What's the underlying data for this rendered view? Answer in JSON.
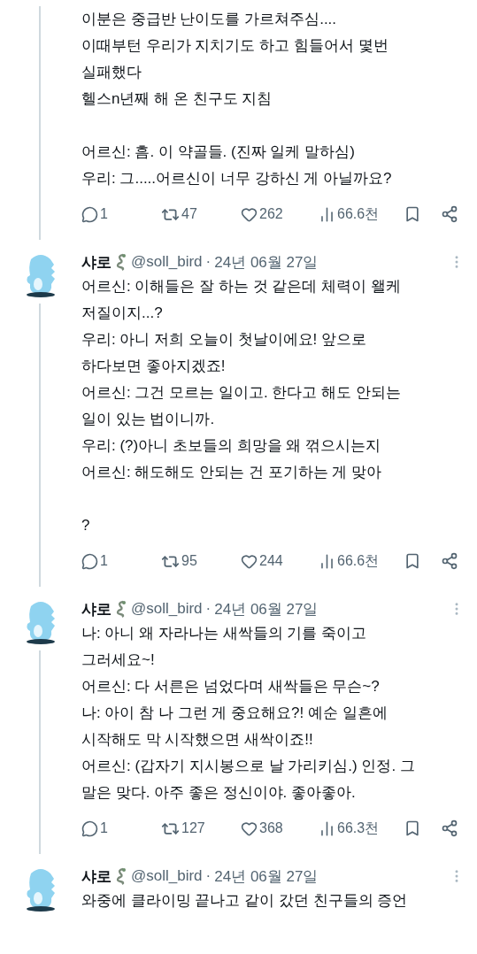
{
  "posts": [
    {
      "body": "이분은 중급반 난이도를 가르쳐주심....\n이때부턴 우리가 지치기도 하고 힘들어서 몇번\n실패했다\n헬스n년째 해 온 친구도 지침\n\n어르신: 흠. 이 약골들. (진짜 일케 말하심)\n우리: 그.....어르신이 너무 강하신 게 아닐까요?",
      "stats": {
        "replies": "1",
        "reposts": "47",
        "likes": "262",
        "views": "66.6천"
      }
    },
    {
      "author": {
        "name": "샤로",
        "handle": "@soll_bird",
        "separator": "·",
        "date": "24년 06월 27일"
      },
      "body": "어르신: 이해들은 잘 하는 것 같은데 체력이 왤케\n저질이지...?\n우리: 아니 저희 오늘이 첫날이에요! 앞으로\n하다보면 좋아지겠죠!\n어르신: 그건 모르는 일이고. 한다고 해도 안되는\n일이 있는 법이니까.\n우리: (?)아니 초보들의 희망을 왜 꺾으시는지\n어르신: 해도해도 안되는 건 포기하는 게 맞아\n\n?",
      "stats": {
        "replies": "1",
        "reposts": "95",
        "likes": "244",
        "views": "66.6천"
      }
    },
    {
      "author": {
        "name": "샤로",
        "handle": "@soll_bird",
        "separator": "·",
        "date": "24년 06월 27일"
      },
      "body": "나: 아니 왜 자라나는 새싹들의 기를 죽이고\n그러세요~!\n어르신: 다 서른은 넘었다며 새싹들은 무슨~?\n나: 아이 참 나 그런 게 중요해요?! 예순 일흔에\n시작해도 막 시작했으면 새싹이죠!!\n어르신: (갑자기 지시봉으로 날 가리키심.) 인정. 그\n말은 맞다. 아주 좋은 정신이야. 좋아좋아.",
      "stats": {
        "replies": "1",
        "reposts": "127",
        "likes": "368",
        "views": "66.3천"
      }
    },
    {
      "author": {
        "name": "샤로",
        "handle": "@soll_bird",
        "separator": "·",
        "date": "24년 06월 27일"
      },
      "body": "와중에 클라이밍 끝나고 같이 갔던 친구들의 증언"
    }
  ]
}
